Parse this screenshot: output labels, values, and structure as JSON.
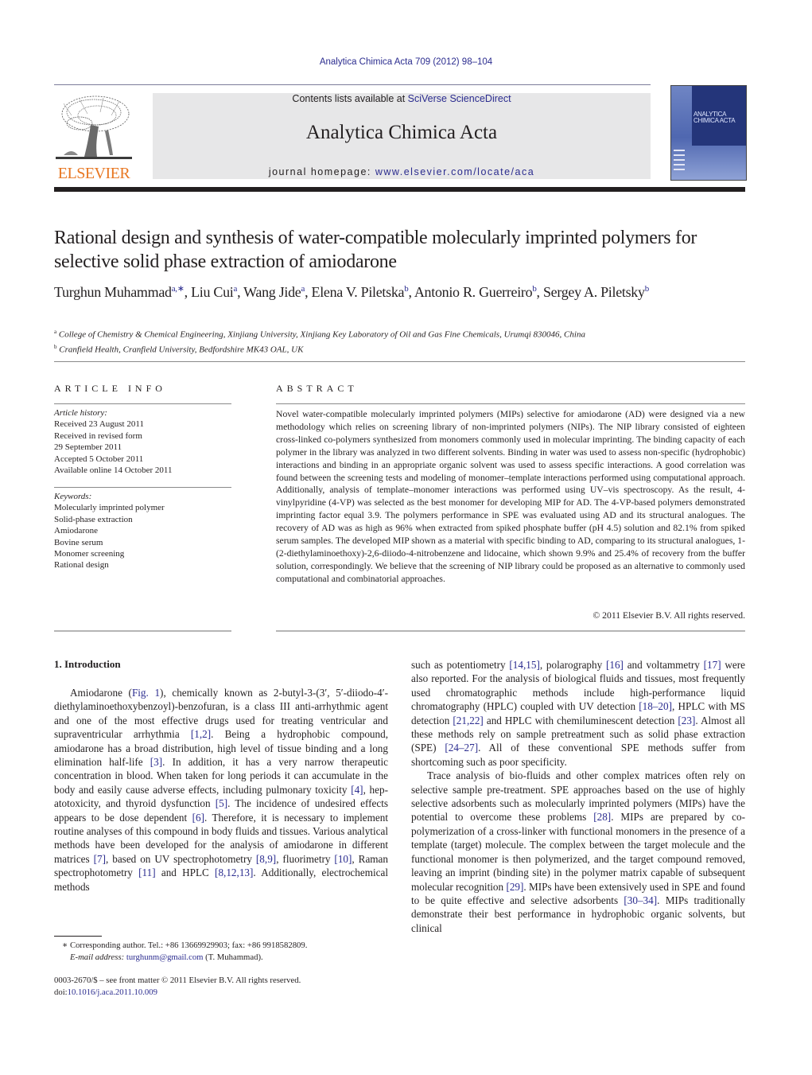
{
  "header": {
    "journal_reference": "Analytica Chimica Acta 709 (2012) 98–104",
    "contents_prefix": "Contents lists available at ",
    "contents_link": "SciVerse ScienceDirect",
    "journal_title": "Analytica Chimica Acta",
    "homepage_prefix": "journal homepage: ",
    "homepage_link": "www.elsevier.com/locate/aca",
    "publisher_logo_text": "ELSEVIER",
    "cover_title_line1": "ANALYTICA",
    "cover_title_line2": "CHIMICA ACTA",
    "colors": {
      "link": "#2b2c8f",
      "logo": "#e87722",
      "banner": "#e7e7e8"
    }
  },
  "article": {
    "title": "Rational design and synthesis of water-compatible molecularly imprinted polymers for selective solid phase extraction of amiodarone",
    "authors": [
      {
        "name": "Turghun Muhammad",
        "aff": "a,∗",
        "sep": ", "
      },
      {
        "name": "Liu Cui",
        "aff": "a",
        "sep": ", "
      },
      {
        "name": "Wang Jide",
        "aff": "a",
        "sep": ", "
      },
      {
        "name": "Elena V. Piletska",
        "aff": "b",
        "sep": ", "
      },
      {
        "name": "Antonio R. Guerreiro",
        "aff": "b",
        "sep": ", "
      },
      {
        "name": "Sergey A. Piletsky",
        "aff": "b",
        "sep": ""
      }
    ],
    "affiliations": [
      {
        "key": "a",
        "text": "College of Chemistry & Chemical Engineering, Xinjiang University, Xinjiang Key Laboratory of Oil and Gas Fine Chemicals, Urumqi 830046, China"
      },
      {
        "key": "b",
        "text": "Cranfield Health, Cranfield University, Bedfordshire MK43 OAL, UK"
      }
    ]
  },
  "article_info": {
    "heading": "ARTICLE INFO",
    "history_label": "Article history:",
    "history": [
      "Received 23 August 2011",
      "Received in revised form",
      "29 September 2011",
      "Accepted 5 October 2011",
      "Available online 14 October 2011"
    ],
    "keywords_label": "Keywords:",
    "keywords": [
      "Molecularly imprinted polymer",
      "Solid-phase extraction",
      "Amiodarone",
      "Bovine serum",
      "Monomer screening",
      "Rational design"
    ]
  },
  "abstract": {
    "heading": "ABSTRACT",
    "text": "Novel water-compatible molecularly imprinted polymers (MIPs) selective for amiodarone (AD) were designed via a new methodology which relies on screening library of non-imprinted polymers (NIPs). The NIP library consisted of eighteen cross-linked co-polymers synthesized from monomers commonly used in molecular imprinting. The binding capacity of each polymer in the library was analyzed in two different solvents. Binding in water was used to assess non-specific (hydrophobic) interactions and bind­ing in an appropriate organic solvent was used to assess specific interactions. A good correlation was found between the screening tests and modeling of monomer–template interactions performed using computational approach. Additionally, analysis of template–monomer interactions was performed using UV–vis spectroscopy. As the result, 4-vinylpyridine (4-VP) was selected as the best monomer for devel­oping MIP for AD. The 4-VP-based polymers demonstrated imprinting factor equal 3.9. The polymers performance in SPE was evaluated using AD and its structural analogues. The recovery of AD was as high as 96% when extracted from spiked phosphate buffer (pH 4.5) solution and 82.1% from spiked serum samples. The developed MIP shown as a material with specific binding to AD, comparing to its structural analogues, 1-(2-diethylaminoethoxy)-2,6-diiodo-4-nitrobenzene and lidocaine, which shown 9.9% and 25.4% of recovery from the buffer solution, correspondingly. We believe that the screening of NIP library could be proposed as an alternative to commonly used computational and combinatorial approaches.",
    "copyright": "© 2011 Elsevier B.V. All rights reserved."
  },
  "introduction": {
    "heading": "1.  Introduction",
    "left_column": [
      [
        {
          "t": "Amiodarone ("
        },
        {
          "l": "Fig. 1"
        },
        {
          "t": "), chemically known as 2-butyl-3-(3′, 5′-diiodo-4′-diethylaminoethoxybenzoyl)-benzofuran, is a class III anti-arrhythmic agent and one of the most effective drugs used for treating ventricular and supraventricular arrhythmia "
        },
        {
          "l": "[1,2]"
        },
        {
          "t": ". Being a hydrophobic compound, amiodarone has a broad distribution, high level of tissue binding and a long elimination half-life "
        },
        {
          "l": "[3]"
        },
        {
          "t": ". In addition, it has a very narrow therapeutic concentration in blood. When taken for long periods it can accumulate in the body and easily cause adverse effects, including pulmonary toxicity "
        },
        {
          "l": "[4]"
        },
        {
          "t": ", hep­atotoxicity, and thyroid dysfunction "
        },
        {
          "l": "[5]"
        },
        {
          "t": ". The incidence of undesired effects appears to be dose dependent "
        },
        {
          "l": "[6]"
        },
        {
          "t": ". Therefore, it is necessary to implement routine analyses of this compound in body fluids and tissues. Various analytical methods have been developed for the analysis of amiodarone in different matrices "
        },
        {
          "l": "[7]"
        },
        {
          "t": ", based on UV spec­trophotometry "
        },
        {
          "l": "[8,9]"
        },
        {
          "t": ", fluorimetry "
        },
        {
          "l": "[10]"
        },
        {
          "t": ", Raman spectrophotometry "
        },
        {
          "l": "[11]"
        },
        {
          "t": " and HPLC "
        },
        {
          "l": "[8,12,13]"
        },
        {
          "t": ". Additionally, electrochemical methods"
        }
      ]
    ],
    "right_column": [
      [
        {
          "t": "such as potentiometry "
        },
        {
          "l": "[14,15]"
        },
        {
          "t": ", polarography "
        },
        {
          "l": "[16]"
        },
        {
          "t": " and voltamme­try "
        },
        {
          "l": "[17]"
        },
        {
          "t": " were also reported. For the analysis of biological fluids and tissues, most frequently used chromatographic methods include high-performance liquid chromatography (HPLC) coupled with UV detection "
        },
        {
          "l": "[18–20]"
        },
        {
          "t": ", HPLC with MS detection "
        },
        {
          "l": "[21,22]"
        },
        {
          "t": " and HPLC with chemiluminescent detection "
        },
        {
          "l": "[23]"
        },
        {
          "t": ". Almost all these methods rely on sample pretreatment such as solid phase extraction (SPE) "
        },
        {
          "l": "[24–27]"
        },
        {
          "t": ". All of these conventional SPE methods suffer from shortcoming such as poor specificity."
        }
      ],
      [
        {
          "t": "Trace analysis of bio-fluids and other complex matrices often rely on selective sample pre-treatment. SPE approaches based on the use of highly selective adsorbents such as molecularly imprinted polymers (MIPs) have the potential to overcome these problems "
        },
        {
          "l": "[28]"
        },
        {
          "t": ". MIPs are prepared by co-polymerization of a cross-linker with functional monomers in the presence of a template (target) molecule. The complex between the target molecule and the functional monomer is then polymerized, and the target com­pound removed, leaving an imprint (binding site) in the polymer matrix capable of subsequent molecular recognition "
        },
        {
          "l": "[29]"
        },
        {
          "t": ". MIPs have been extensively used in SPE and found to be quite effective and selective adsorbents "
        },
        {
          "l": "[30–34]"
        },
        {
          "t": ". MIPs traditionally demonstrate their best performance in hydrophobic organic solvents, but clinical"
        }
      ]
    ]
  },
  "footnote": {
    "marker": "∗",
    "corresponding": "Corresponding author. Tel.: +86 13669929903; fax: +86 9918582809.",
    "email_label": "E-mail address:",
    "email": "turghunm@gmail.com",
    "email_suffix": " (T. Muhammad)."
  },
  "front_matter": {
    "issn_line": "0003-2670/$ – see front matter © 2011 Elsevier B.V. All rights reserved.",
    "doi_prefix": "doi:",
    "doi": "10.1016/j.aca.2011.10.009"
  }
}
